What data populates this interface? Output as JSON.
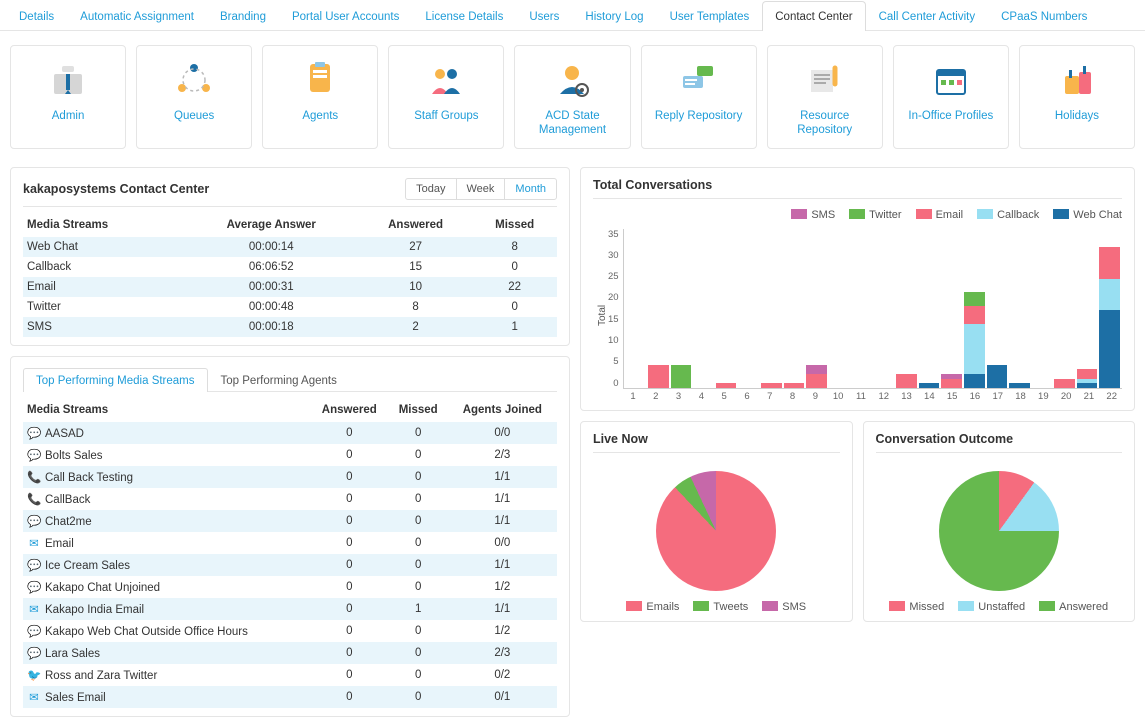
{
  "topnav": {
    "tabs": [
      {
        "label": "Details"
      },
      {
        "label": "Automatic Assignment"
      },
      {
        "label": "Branding"
      },
      {
        "label": "Portal User Accounts"
      },
      {
        "label": "License Details"
      },
      {
        "label": "Users"
      },
      {
        "label": "History Log"
      },
      {
        "label": "User Templates"
      },
      {
        "label": "Contact Center",
        "active": true
      },
      {
        "label": "Call Center Activity"
      },
      {
        "label": "CPaaS Numbers"
      }
    ]
  },
  "tiles": [
    {
      "name": "admin",
      "label": "Admin"
    },
    {
      "name": "queues",
      "label": "Queues"
    },
    {
      "name": "agents",
      "label": "Agents"
    },
    {
      "name": "staff-groups",
      "label": "Staff Groups"
    },
    {
      "name": "acd-state",
      "label": "ACD State Management"
    },
    {
      "name": "reply-repository",
      "label": "Reply Repository"
    },
    {
      "name": "resource-repository",
      "label": "Resource Repository"
    },
    {
      "name": "in-office-profiles",
      "label": "In-Office Profiles"
    },
    {
      "name": "holidays",
      "label": "Holidays"
    }
  ],
  "overview": {
    "title": "kakaposystems Contact Center",
    "range_options": [
      "Today",
      "Week",
      "Month"
    ],
    "range_active": "Month",
    "cols": [
      "Media Streams",
      "Average Answer",
      "Answered",
      "Missed"
    ],
    "rows": [
      {
        "stream": "Web Chat",
        "avg": "00:00:14",
        "answered": 27,
        "missed": 8
      },
      {
        "stream": "Callback",
        "avg": "06:06:52",
        "answered": 15,
        "missed": 0
      },
      {
        "stream": "Email",
        "avg": "00:00:31",
        "answered": 10,
        "missed": 22
      },
      {
        "stream": "Twitter",
        "avg": "00:00:48",
        "answered": 8,
        "missed": 0
      },
      {
        "stream": "SMS",
        "avg": "00:00:18",
        "answered": 2,
        "missed": 1
      }
    ]
  },
  "performance": {
    "subtabs": [
      "Top Performing Media Streams",
      "Top Performing Agents"
    ],
    "active_subtab": "Top Performing Media Streams",
    "cols": [
      "Media Streams",
      "Answered",
      "Missed",
      "Agents Joined"
    ],
    "rows": [
      {
        "icon": "chat",
        "name": "AASAD",
        "answered": 0,
        "missed": 0,
        "agents": "0/0"
      },
      {
        "icon": "chat",
        "name": "Bolts Sales",
        "answered": 0,
        "missed": 0,
        "agents": "2/3"
      },
      {
        "icon": "phone",
        "name": "Call Back Testing",
        "answered": 0,
        "missed": 0,
        "agents": "1/1"
      },
      {
        "icon": "phone",
        "name": "CallBack",
        "answered": 0,
        "missed": 0,
        "agents": "1/1"
      },
      {
        "icon": "chat",
        "name": "Chat2me",
        "answered": 0,
        "missed": 0,
        "agents": "1/1"
      },
      {
        "icon": "mail",
        "name": "Email",
        "answered": 0,
        "missed": 0,
        "agents": "0/0"
      },
      {
        "icon": "chat",
        "name": "Ice Cream Sales",
        "answered": 0,
        "missed": 0,
        "agents": "1/1"
      },
      {
        "icon": "chat",
        "name": "Kakapo Chat Unjoined",
        "answered": 0,
        "missed": 0,
        "agents": "1/2"
      },
      {
        "icon": "mail",
        "name": "Kakapo India Email",
        "answered": 0,
        "missed": 1,
        "agents": "1/1"
      },
      {
        "icon": "chat",
        "name": "Kakapo Web Chat Outside Office Hours",
        "answered": 0,
        "missed": 0,
        "agents": "1/2"
      },
      {
        "icon": "chat",
        "name": "Lara Sales",
        "answered": 0,
        "missed": 0,
        "agents": "2/3"
      },
      {
        "icon": "twitter",
        "name": "Ross and Zara Twitter",
        "answered": 0,
        "missed": 0,
        "agents": "0/2"
      },
      {
        "icon": "mail",
        "name": "Sales Email",
        "answered": 0,
        "missed": 0,
        "agents": "0/1"
      }
    ]
  },
  "total_conversations_title": "Total Conversations",
  "live_now_title": "Live Now",
  "outcome_title": "Conversation Outcome",
  "chart_data": [
    {
      "id": "total-conversations",
      "type": "bar",
      "stacked": true,
      "title": "Total Conversations",
      "ylabel": "Total",
      "ylim": [
        0,
        35
      ],
      "yticks": [
        0,
        5,
        10,
        15,
        20,
        25,
        30,
        35
      ],
      "categories": [
        "1",
        "2",
        "3",
        "4",
        "5",
        "6",
        "7",
        "8",
        "9",
        "10",
        "11",
        "12",
        "13",
        "14",
        "15",
        "16",
        "17",
        "18",
        "19",
        "20",
        "21",
        "22"
      ],
      "series": [
        {
          "name": "SMS",
          "color": "#c668a9",
          "values": [
            0,
            0,
            0,
            0,
            0,
            0,
            0,
            0,
            2,
            0,
            0,
            0,
            0,
            0,
            1,
            0,
            0,
            0,
            0,
            0,
            0,
            0
          ]
        },
        {
          "name": "Twitter",
          "color": "#66b94e",
          "values": [
            0,
            0,
            5,
            0,
            0,
            0,
            0,
            0,
            0,
            0,
            0,
            0,
            0,
            0,
            0,
            3,
            0,
            0,
            0,
            0,
            0,
            0
          ]
        },
        {
          "name": "Email",
          "color": "#f56c7e",
          "values": [
            0,
            5,
            0,
            0,
            1,
            0,
            1,
            1,
            3,
            0,
            0,
            0,
            3,
            0,
            2,
            4,
            0,
            0,
            0,
            2,
            2,
            7
          ]
        },
        {
          "name": "Callback",
          "color": "#98dff2",
          "values": [
            0,
            0,
            0,
            0,
            0,
            0,
            0,
            0,
            0,
            0,
            0,
            0,
            0,
            0,
            0,
            11,
            0,
            0,
            0,
            0,
            1,
            7
          ]
        },
        {
          "name": "Web Chat",
          "color": "#1d6fa5",
          "values": [
            0,
            0,
            0,
            0,
            0,
            0,
            0,
            0,
            0,
            0,
            0,
            0,
            0,
            1,
            0,
            3,
            5,
            1,
            0,
            0,
            1,
            17
          ]
        }
      ],
      "legend_position": "top-right"
    },
    {
      "id": "live-now",
      "type": "pie",
      "title": "Live Now",
      "slices": [
        {
          "name": "Emails",
          "color": "#f56c7e",
          "value": 88
        },
        {
          "name": "Tweets",
          "color": "#66b94e",
          "value": 5
        },
        {
          "name": "SMS",
          "color": "#c668a9",
          "value": 7
        }
      ]
    },
    {
      "id": "conversation-outcome",
      "type": "pie",
      "title": "Conversation Outcome",
      "slices": [
        {
          "name": "Missed",
          "color": "#f56c7e",
          "value": 10
        },
        {
          "name": "Unstaffed",
          "color": "#98dff2",
          "value": 15
        },
        {
          "name": "Answered",
          "color": "#66b94e",
          "value": 75
        }
      ]
    }
  ],
  "legends": {
    "bar": [
      "SMS",
      "Twitter",
      "Email",
      "Callback",
      "Web Chat"
    ],
    "live": [
      "Emails",
      "Tweets",
      "SMS"
    ],
    "outcome": [
      "Missed",
      "Unstaffed",
      "Answered"
    ]
  }
}
